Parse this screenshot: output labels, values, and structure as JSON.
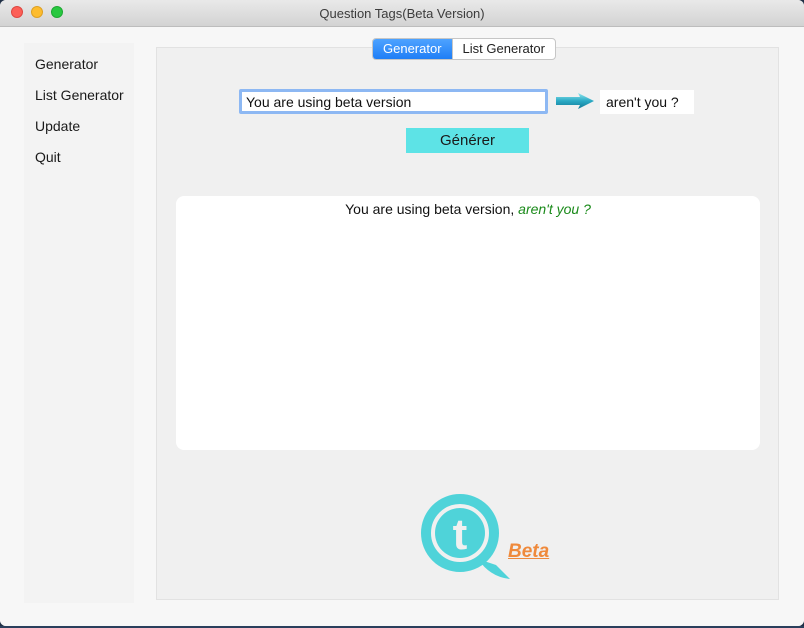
{
  "window": {
    "title": "Question Tags(Beta Version)"
  },
  "sidebar": {
    "items": [
      {
        "label": "Generator"
      },
      {
        "label": "List Generator"
      },
      {
        "label": "Update"
      },
      {
        "label": "Quit"
      }
    ]
  },
  "tabs": [
    {
      "label": "Generator",
      "active": true
    },
    {
      "label": "List Generator",
      "active": false
    }
  ],
  "generator": {
    "input_value": "You are using beta version",
    "arrow_icon": "arrow-right-icon",
    "result": "aren't you ?",
    "button_label": "Générer"
  },
  "output": {
    "sentence": "You are using beta version,",
    "tag": "aren't you ?"
  },
  "logo": {
    "letter": "t",
    "badge": "Beta"
  },
  "colors": {
    "accent_button": "#5de3e6",
    "tab_active": "#1f7ef6",
    "tag_text": "#1a8a1a",
    "beta_text": "#ef8a3c",
    "logo": "#4fd3d9"
  }
}
